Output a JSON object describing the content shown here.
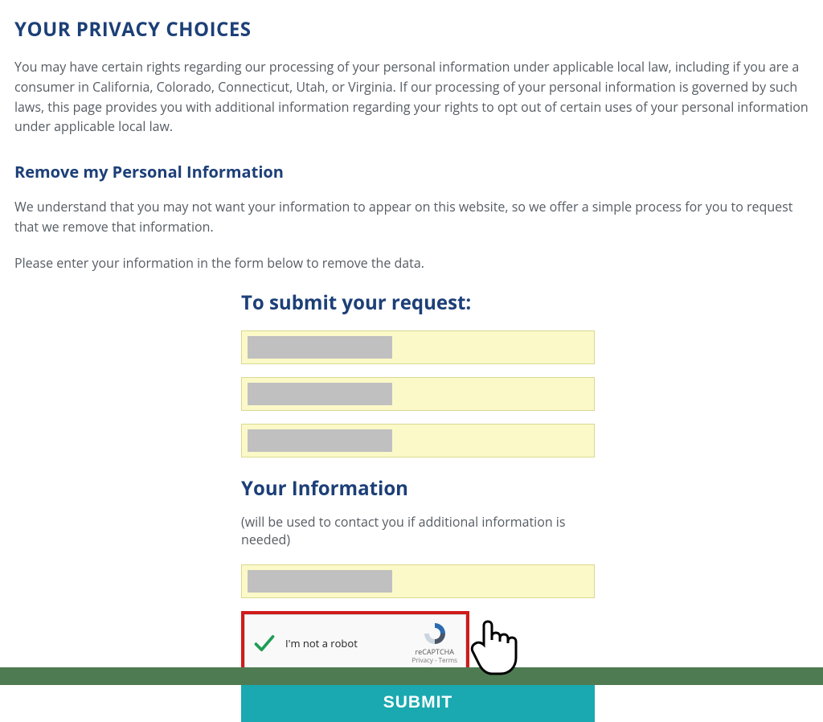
{
  "page": {
    "title": "YOUR PRIVACY CHOICES",
    "intro": "You may have certain rights regarding our processing of your personal information under applicable local law, including if you are a consumer in California, Colorado, Connecticut, Utah, or Virginia. If our processing of your personal information is governed by such laws, this page provides you with additional information regarding your rights to opt out of certain uses of your personal information under applicable local law."
  },
  "section_remove": {
    "heading": "Remove my Personal Information",
    "body1": "We understand that you may not want your information to appear on this website, so we offer a simple process for you to request that we remove that information.",
    "body2": "Please enter your information in the form below to remove the data."
  },
  "form": {
    "heading": "To submit your request:",
    "inputs": {
      "field1": "",
      "field2": "",
      "field3": "",
      "contact_field": ""
    },
    "info_heading": "Your Information",
    "info_sub": "(will be used to contact you if additional information is needed)",
    "recaptcha": {
      "label": "I'm not a robot",
      "brand": "reCAPTCHA",
      "privacy": "Privacy",
      "terms": "Terms",
      "separator": " - ",
      "checked": true
    },
    "submit_label": "SUBMIT"
  },
  "colors": {
    "heading": "#1c3f77",
    "body_text": "#555c63",
    "input_bg": "#fcf9c8",
    "input_border": "#d9d891",
    "submit_bg": "#1aa9b0",
    "highlight_border": "#d21b1b",
    "footer_bar": "#4f7b52"
  }
}
